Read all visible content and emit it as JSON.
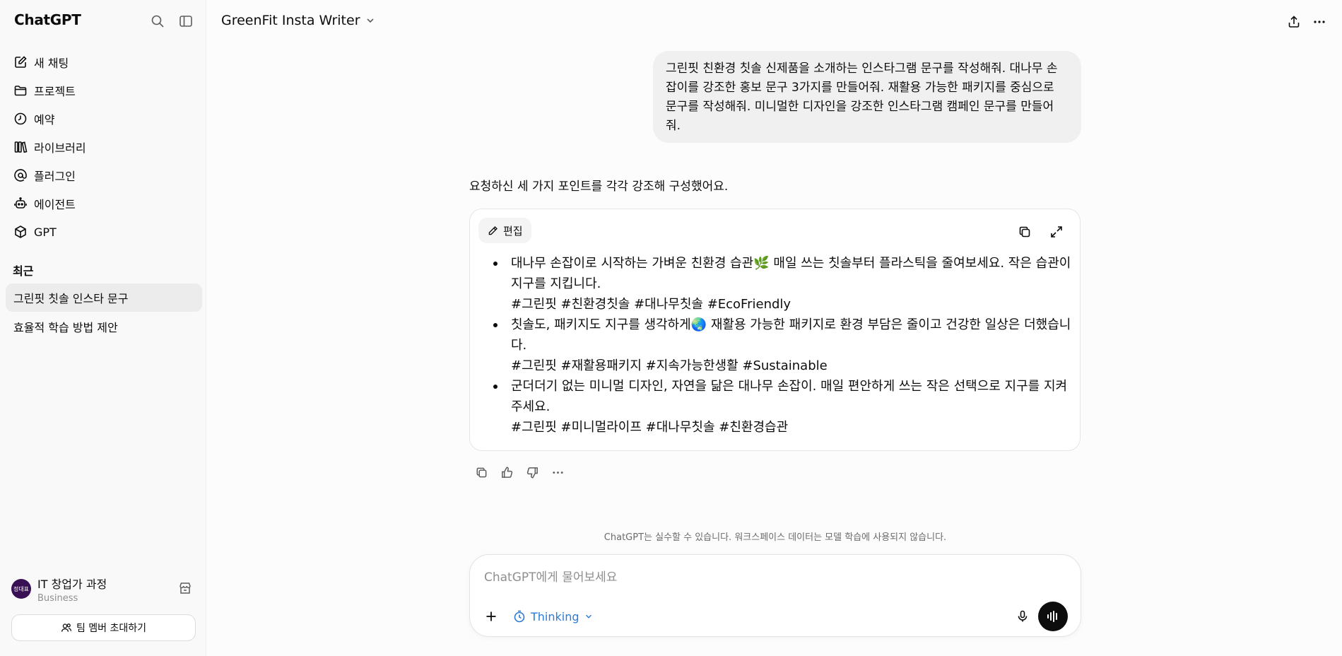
{
  "sidebar": {
    "brand": "ChatGPT",
    "nav": [
      {
        "label": "새 채팅",
        "icon": "new-chat-icon"
      },
      {
        "label": "프로젝트",
        "icon": "folder-icon"
      },
      {
        "label": "예약",
        "icon": "clock-icon"
      },
      {
        "label": "라이브러리",
        "icon": "library-icon"
      },
      {
        "label": "플러그인",
        "icon": "plugin-icon"
      },
      {
        "label": "에이전트",
        "icon": "agent-icon"
      },
      {
        "label": "GPT",
        "icon": "cube-icon"
      }
    ],
    "recent_title": "최근",
    "recent": [
      {
        "label": "그린핏 칫솔 인스타 문구",
        "active": true
      },
      {
        "label": "효율적 학습 방법 제안",
        "active": false
      }
    ],
    "account": {
      "name": "IT 창업가 과정",
      "plan": "Business",
      "avatar_text": "정대표"
    },
    "invite_label": "팀 멤버 초대하기"
  },
  "header": {
    "title": "GreenFit Insta Writer"
  },
  "conversation": {
    "user_message": "그린핏 친환경 칫솔 신제품을 소개하는 인스타그램 문구를 작성해줘. 대나무 손잡이를 강조한 홍보 문구 3가지를 만들어줘. 재활용 가능한 패키지를 중심으로 문구를 작성해줘. 미니멀한 디자인을 강조한 인스타그램 캠페인 문구를 만들어줘.",
    "assistant_intro": "요청하신 세 가지 포인트를 각각 강조해 구성했어요.",
    "canvas": {
      "edit_label": "편집",
      "items": [
        {
          "text": "대나무 손잡이로 시작하는 가벼운 친환경 습관🌿 매일 쓰는 칫솔부터 플라스틱을 줄여보세요. 작은 습관이 지구를 지킵니다.",
          "tags": "#그린핏 #친환경칫솔 #대나무칫솔 #EcoFriendly"
        },
        {
          "text": "칫솔도, 패키지도 지구를 생각하게🌏 재활용 가능한 패키지로 환경 부담은 줄이고 건강한 일상은 더했습니다.",
          "tags": "#그린핏 #재활용패키지 #지속가능한생활 #Sustainable"
        },
        {
          "text": "군더더기 없는 미니멀 디자인, 자연을 닮은 대나무 손잡이. 매일 편안하게 쓰는 작은 선택으로 지구를 지켜주세요.",
          "tags": "#그린핏 #미니멀라이프 #대나무칫솔 #친환경습관"
        }
      ]
    }
  },
  "disclaimer": "ChatGPT는 실수할 수 있습니다. 워크스페이스 데이터는 모델 학습에 사용되지 않습니다.",
  "composer": {
    "placeholder": "ChatGPT에게 물어보세요",
    "mode_label": "Thinking"
  },
  "colors": {
    "accent": "#2a7bd6",
    "sidebar_bg": "#f9f9f9",
    "bubble_bg": "#f0f0f0"
  }
}
